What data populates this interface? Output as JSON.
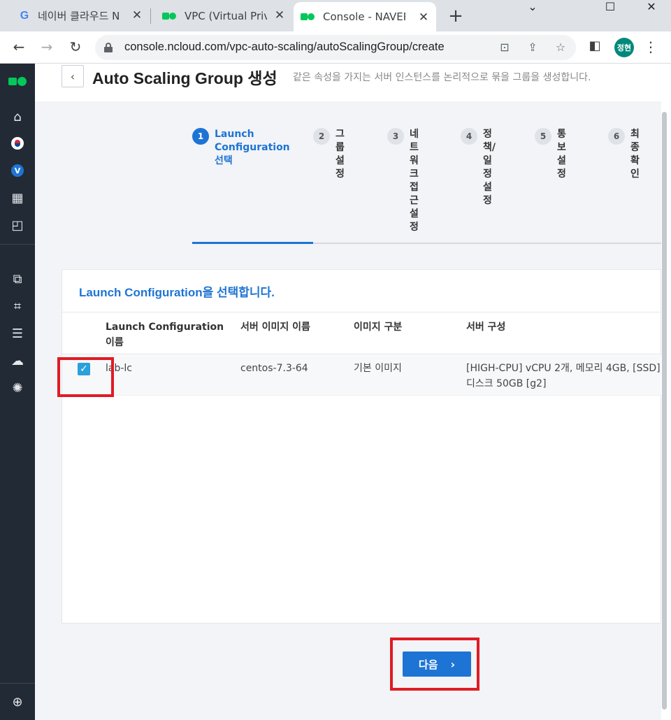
{
  "browser": {
    "tabs": [
      {
        "title": "네이버 클라우드 N",
        "favicon": "google-g-icon"
      },
      {
        "title": "VPC (Virtual Privat",
        "favicon": "naver-cloud-icon"
      },
      {
        "title": "Console - NAVER",
        "favicon": "naver-cloud-icon",
        "active": true
      }
    ],
    "new_tab": "+",
    "window_controls": {
      "minimize": "⌄",
      "maximize": "☐",
      "close": "✕"
    },
    "url": "console.ncloud.com/vpc-auto-scaling/autoScalingGroup/create",
    "profile_initials": "정현"
  },
  "sidenav": {
    "icons": [
      "home-icon",
      "region-flag-icon",
      "vpc-badge-icon",
      "services-grid-icon",
      "dashboard-icon",
      "copy-resources-icon",
      "network-topology-icon",
      "server-list-icon",
      "cloud-settings-icon",
      "gear-cluster-icon",
      "globe-icon"
    ],
    "vpc_badge": "V"
  },
  "page": {
    "back": "‹",
    "title": "Auto Scaling Group 생성",
    "description": "같은 속성을 가지는 서버 인스턴스를 논리적으로 묶을 그룹을 생성합니다."
  },
  "steps": [
    {
      "num": "1",
      "label": "Launch Configuration 선택",
      "active": true
    },
    {
      "num": "2",
      "label": "그룹설정"
    },
    {
      "num": "3",
      "label": "네트워크접근설정"
    },
    {
      "num": "4",
      "label": "정책/일정설정"
    },
    {
      "num": "5",
      "label": "통보설정"
    },
    {
      "num": "6",
      "label": "최종확인"
    }
  ],
  "card": {
    "title": "Launch Configuration을 선택합니다.",
    "columns": [
      "Launch Configuration 이름",
      "서버 이미지 이름",
      "이미지 구분",
      "서버 구성"
    ],
    "rows": [
      {
        "checked": true,
        "name": "lab-lc",
        "image": "centos-7.3-64",
        "type": "기본 이미지",
        "spec": "[HIGH-CPU] vCPU 2개, 메모리 4GB, [SSD]디스크 50GB [g2]"
      }
    ]
  },
  "next_button": {
    "label": "다음",
    "chevron": "›"
  },
  "colors": {
    "accent": "#1e74d4",
    "sidebar": "#222a35",
    "highlight": "#e01b24",
    "checkbox": "#2aa0dc"
  }
}
